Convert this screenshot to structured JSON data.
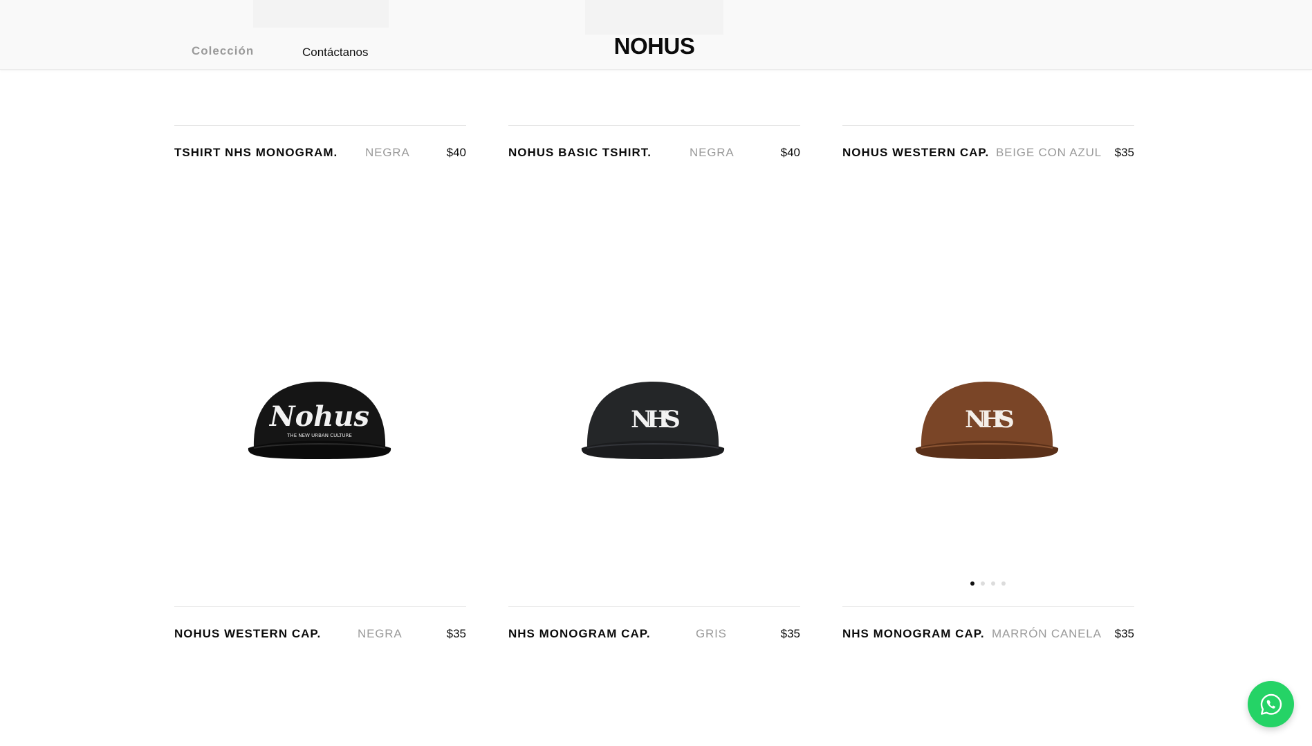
{
  "header": {
    "nav": {
      "collection_label": "Colección",
      "contact_label": "Contáctanos"
    },
    "brand": "NOHUS"
  },
  "products_top": [
    {
      "name": "TSHIRT NHS MONOGRAM.",
      "color": "NEGRA",
      "price": "$40"
    },
    {
      "name": "NOHUS BASIC TSHIRT.",
      "color": "NEGRA",
      "price": "$40"
    },
    {
      "name": "NOHUS WESTERN CAP.",
      "color": "BEIGE CON AZUL",
      "price": "$35"
    }
  ],
  "products_bottom": [
    {
      "name": "NOHUS WESTERN CAP.",
      "color": "NEGRA",
      "price": "$35",
      "image": "black-script-cap",
      "logo_text": "Nohus",
      "logo_subtext": "THE NEW URBAN CULTURE",
      "cap_color": "#151515"
    },
    {
      "name": "NHS MONOGRAM CAP.",
      "color": "GRIS",
      "price": "$35",
      "image": "charcoal-monogram-cap",
      "logo_text": "NHS",
      "cap_color": "#242628"
    },
    {
      "name": "NHS MONOGRAM CAP.",
      "color": "MARRÓN CANELA",
      "price": "$35",
      "image": "brown-monogram-cap",
      "logo_text": "NHS",
      "cap_color": "#7a4527",
      "carousel": {
        "slides": 4,
        "active": 1
      }
    }
  ],
  "whatsapp": {
    "icon": "whatsapp-icon",
    "color": "#25d366"
  }
}
